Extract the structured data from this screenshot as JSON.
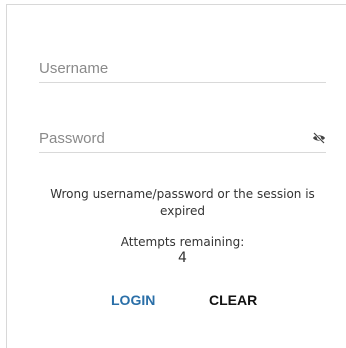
{
  "form": {
    "username": {
      "placeholder": "Username",
      "value": ""
    },
    "password": {
      "placeholder": "Password",
      "value": "",
      "toggle_icon": "eye-off-icon"
    }
  },
  "messages": {
    "error": "Wrong username/password or the session is expired",
    "attempts_label": "Attempts remaining:",
    "attempts_count": "4"
  },
  "buttons": {
    "login_label": "LOGIN",
    "clear_label": "CLEAR"
  },
  "colors": {
    "login": "#2a6fa8",
    "clear": "#111111",
    "text": "#333333",
    "divider": "#d9d9d9"
  }
}
